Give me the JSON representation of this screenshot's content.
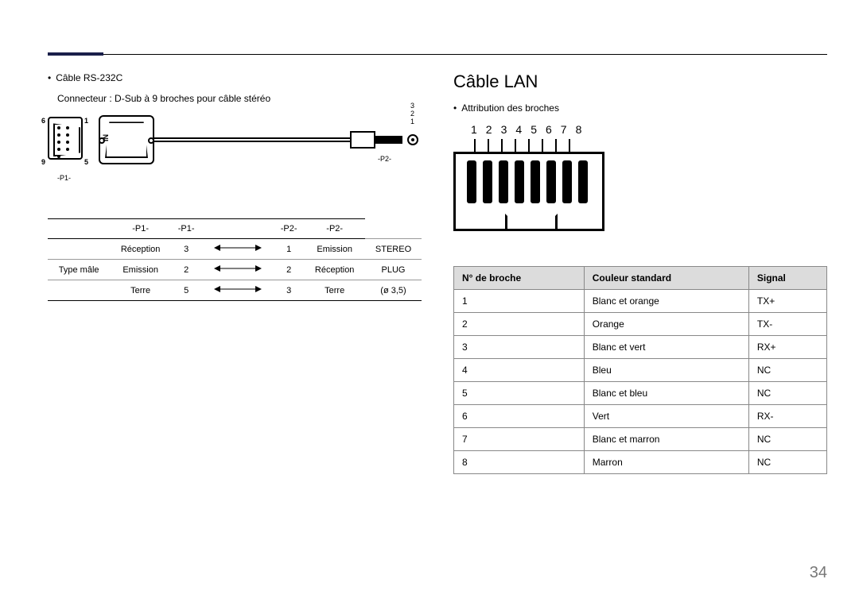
{
  "page_number": "34",
  "left": {
    "bullet_title": "Câble RS-232C",
    "bullet_sub": "Connecteur : D-Sub à 9 broches pour câble stéréo",
    "dsub_pins": {
      "tl": "6",
      "tr": "1",
      "bl": "9",
      "br": "5"
    },
    "p1_label": "-P1-",
    "p2_label": "-P2-",
    "in_label": "IN",
    "jack_nums": [
      "3",
      "2",
      "1"
    ],
    "row_label": "Type mâle",
    "table": {
      "headers": [
        "-P1-",
        "-P1-",
        "",
        "-P2-",
        "-P2-"
      ],
      "rows": [
        [
          "Réception",
          "3",
          "1",
          "Emission",
          "STEREO"
        ],
        [
          "Emission",
          "2",
          "2",
          "Réception",
          "PLUG"
        ],
        [
          "Terre",
          "5",
          "3",
          "Terre",
          "(ø 3,5)"
        ]
      ]
    }
  },
  "right": {
    "title": "Câble LAN",
    "bullet": "Attribution des broches",
    "pin_nums": [
      "1",
      "2",
      "3",
      "4",
      "5",
      "6",
      "7",
      "8"
    ],
    "table": {
      "headers": [
        "N° de broche",
        "Couleur standard",
        "Signal"
      ],
      "rows": [
        [
          "1",
          "Blanc et orange",
          "TX+"
        ],
        [
          "2",
          "Orange",
          "TX-"
        ],
        [
          "3",
          "Blanc et vert",
          "RX+"
        ],
        [
          "4",
          "Bleu",
          "NC"
        ],
        [
          "5",
          "Blanc et bleu",
          "NC"
        ],
        [
          "6",
          "Vert",
          "RX-"
        ],
        [
          "7",
          "Blanc et marron",
          "NC"
        ],
        [
          "8",
          "Marron",
          "NC"
        ]
      ]
    }
  }
}
